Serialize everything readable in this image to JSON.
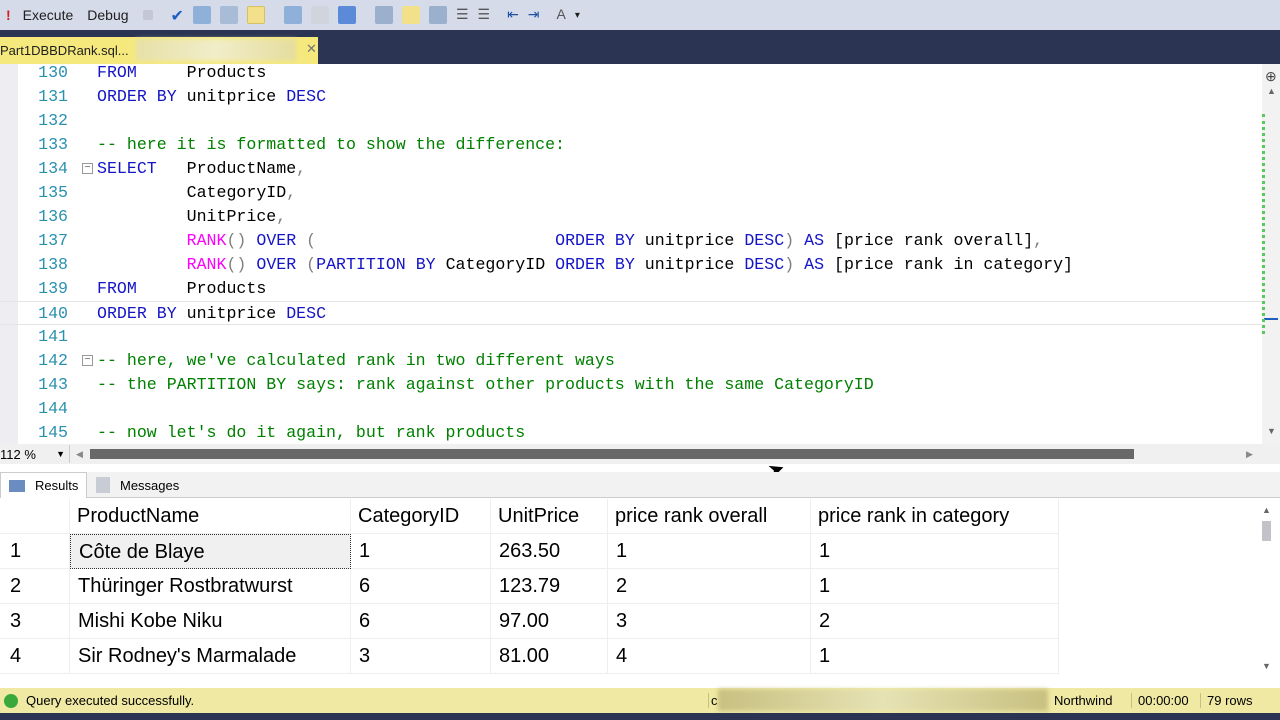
{
  "toolbar": {
    "execute": "Execute",
    "debug": "Debug"
  },
  "tab": {
    "title": "Part1DBBDRank.sql..."
  },
  "editor": {
    "lines": [
      {
        "n": "130",
        "tokens": [
          [
            "FROM",
            "k"
          ],
          [
            "     Products",
            "p"
          ]
        ]
      },
      {
        "n": "131",
        "tokens": [
          [
            "ORDER BY",
            "k"
          ],
          [
            " unitprice ",
            "p"
          ],
          [
            "DESC",
            "k"
          ]
        ]
      },
      {
        "n": "132",
        "tokens": []
      },
      {
        "n": "133",
        "tokens": [
          [
            "-- here it is formatted to show the difference:",
            "c"
          ]
        ]
      },
      {
        "n": "134",
        "fold": true,
        "tokens": [
          [
            "SELECT",
            "k"
          ],
          [
            "   ProductName",
            "p"
          ],
          [
            ",",
            "g"
          ]
        ]
      },
      {
        "n": "135",
        "tokens": [
          [
            "         CategoryID",
            "p"
          ],
          [
            ",",
            "g"
          ]
        ]
      },
      {
        "n": "136",
        "tokens": [
          [
            "         UnitPrice",
            "p"
          ],
          [
            ",",
            "g"
          ]
        ]
      },
      {
        "n": "137",
        "tokens": [
          [
            "         ",
            "p"
          ],
          [
            "RANK",
            "f"
          ],
          [
            "()",
            "g"
          ],
          [
            " ",
            "p"
          ],
          [
            "OVER",
            "k"
          ],
          [
            " (",
            "g"
          ],
          [
            "                        ",
            "p"
          ],
          [
            "ORDER BY",
            "k"
          ],
          [
            " unitprice ",
            "p"
          ],
          [
            "DESC",
            "k"
          ],
          [
            ")",
            "g"
          ],
          [
            " ",
            "p"
          ],
          [
            "AS",
            "k"
          ],
          [
            " [price rank overall]",
            "p"
          ],
          [
            ",",
            "g"
          ]
        ]
      },
      {
        "n": "138",
        "tokens": [
          [
            "         ",
            "p"
          ],
          [
            "RANK",
            "f"
          ],
          [
            "()",
            "g"
          ],
          [
            " ",
            "p"
          ],
          [
            "OVER",
            "k"
          ],
          [
            " (",
            "g"
          ],
          [
            "PARTITION BY",
            "k"
          ],
          [
            " CategoryID ",
            "p"
          ],
          [
            "ORDER BY",
            "k"
          ],
          [
            " unitprice ",
            "p"
          ],
          [
            "DESC",
            "k"
          ],
          [
            ")",
            "g"
          ],
          [
            " ",
            "p"
          ],
          [
            "AS",
            "k"
          ],
          [
            " [price rank in category]",
            "p"
          ]
        ]
      },
      {
        "n": "139",
        "tokens": [
          [
            "FROM",
            "k"
          ],
          [
            "     Products",
            "p"
          ]
        ]
      },
      {
        "n": "140",
        "current": true,
        "tokens": [
          [
            "ORDER BY",
            "k"
          ],
          [
            " unitprice ",
            "p"
          ],
          [
            "DESC",
            "k"
          ]
        ]
      },
      {
        "n": "141",
        "tokens": []
      },
      {
        "n": "142",
        "fold": true,
        "tokens": [
          [
            "-- here, we've calculated rank in two different ways",
            "c"
          ]
        ]
      },
      {
        "n": "143",
        "tokens": [
          [
            "-- the PARTITION BY says: rank against other products with the same CategoryID",
            "c"
          ]
        ]
      },
      {
        "n": "144",
        "tokens": []
      },
      {
        "n": "145",
        "tokens": [
          [
            "-- now let's do it again, but rank products",
            "c"
          ]
        ]
      }
    ]
  },
  "zoom": "112 %",
  "results_tabs": {
    "results": "Results",
    "messages": "Messages"
  },
  "grid": {
    "columns": [
      "ProductName",
      "CategoryID",
      "UnitPrice",
      "price rank overall",
      "price rank in category"
    ],
    "rows": [
      [
        "1",
        "Côte de Blaye",
        "1",
        "263.50",
        "1",
        "1"
      ],
      [
        "2",
        "Thüringer Rostbratwurst",
        "6",
        "123.79",
        "2",
        "1"
      ],
      [
        "3",
        "Mishi Kobe Niku",
        "6",
        "97.00",
        "3",
        "2"
      ],
      [
        "4",
        "Sir Rodney's Marmalade",
        "3",
        "81.00",
        "4",
        "1"
      ]
    ]
  },
  "status": {
    "message": "Query executed successfully.",
    "server_partial": "c",
    "database": "Northwind",
    "elapsed": "00:00:00",
    "rows": "79 rows"
  },
  "colors": {
    "keyword": "#1515c8",
    "comment": "#008000",
    "function": "#ff00ff",
    "gray": "#808080",
    "linenum": "#2b91af"
  }
}
